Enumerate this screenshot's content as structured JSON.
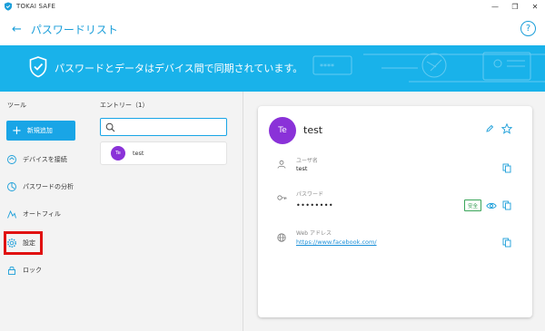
{
  "app": {
    "title": "TOKAI SAFE"
  },
  "window_controls": {
    "minimize": "—",
    "maximize": "❐",
    "close": "✕"
  },
  "header": {
    "back_icon": "←",
    "title": "パスワードリスト",
    "help_icon": "?"
  },
  "banner": {
    "text": "パスワードとデータはデバイス間で同期されています。",
    "color": "#19b2ea",
    "decoration": "****"
  },
  "sidebar": {
    "tool_label": "ツール",
    "add_button": {
      "icon": "+",
      "label": "新規追加"
    },
    "items": [
      {
        "label": "デバイスを接続",
        "icon": "device-sync-icon"
      },
      {
        "label": "パスワードの分析",
        "icon": "analysis-icon"
      },
      {
        "label": "オートフィル",
        "icon": "autofill-icon"
      },
      {
        "label": "設定",
        "icon": "gear-icon",
        "highlighted": true
      },
      {
        "label": "ロック",
        "icon": "lock-icon"
      }
    ]
  },
  "entries": {
    "title": "エントリー（1）",
    "search_placeholder": "",
    "list": [
      {
        "avatar": "Te",
        "name": "test"
      }
    ]
  },
  "detail": {
    "avatar": "Te",
    "title": "test",
    "fields": {
      "username": {
        "label": "ユーザ名",
        "value": "test"
      },
      "password": {
        "label": "パスワード",
        "value": "••••••••",
        "badge": "安全"
      },
      "web_address": {
        "label": "Web アドレス",
        "value": "https://www.facebook.com/"
      }
    }
  },
  "colors": {
    "accent": "#1a9ed9",
    "avatar": "#8a32d8",
    "highlight": "#e01010",
    "safe": "#2e9a4e"
  }
}
